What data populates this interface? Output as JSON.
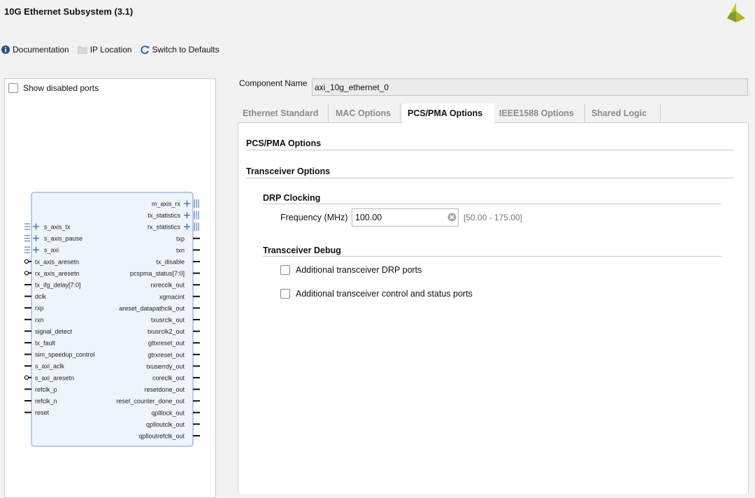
{
  "window": {
    "title": "10G Ethernet Subsystem (3.1)"
  },
  "toolbar": {
    "documentation": "Documentation",
    "ip_location": "IP Location",
    "switch_defaults": "Switch to Defaults"
  },
  "left_panel": {
    "show_disabled_label": "Show disabled ports",
    "left_ports": [
      "s_axis_tx",
      "s_axis_pause",
      "s_axi",
      "tx_axis_aresetn",
      "rx_axis_aresetn",
      "tx_ifg_delay[7:0]",
      "dclk",
      "rxp",
      "rxn",
      "signal_detect",
      "tx_fault",
      "sim_speedup_control",
      "s_axi_aclk",
      "s_axi_aresetn",
      "refclk_p",
      "refclk_n",
      "reset"
    ],
    "right_ports": [
      "m_axis_rx",
      "tx_statistics",
      "rx_statistics",
      "txp",
      "txn",
      "tx_disable",
      "pcspma_status[7:0]",
      "rxrecclk_out",
      "xgmacint",
      "areset_datapathclk_out",
      "txusrclk_out",
      "txusrclk2_out",
      "gttxreset_out",
      "gtrxreset_out",
      "txuserrdy_out",
      "coreclk_out",
      "resetdone_out",
      "reset_counter_done_out",
      "qplllock_out",
      "qplloutclk_out",
      "qplloutrefclk_out"
    ]
  },
  "component": {
    "label": "Component Name",
    "value": "axi_10g_ethernet_0"
  },
  "tabs": [
    {
      "label": "Ethernet Standard",
      "active": false
    },
    {
      "label": "MAC Options",
      "active": false
    },
    {
      "label": "PCS/PMA Options",
      "active": true
    },
    {
      "label": "IEEE1588 Options",
      "active": false
    },
    {
      "label": "Shared Logic",
      "active": false
    }
  ],
  "content": {
    "heading": "PCS/PMA Options",
    "transceiver_options": "Transceiver Options",
    "drp_clocking": "DRP Clocking",
    "frequency_label": "Frequency (MHz)",
    "frequency_value": "100.00",
    "frequency_range": "[50.00 - 175.00]",
    "transceiver_debug": "Transceiver Debug",
    "opt_drp_ports": "Additional transceiver DRP ports",
    "opt_control_status": "Additional transceiver control and status ports"
  },
  "colors": {
    "accent": "#2d6bb5",
    "logo_green": "#9aa52a",
    "block_fill": "#eef4fb"
  }
}
